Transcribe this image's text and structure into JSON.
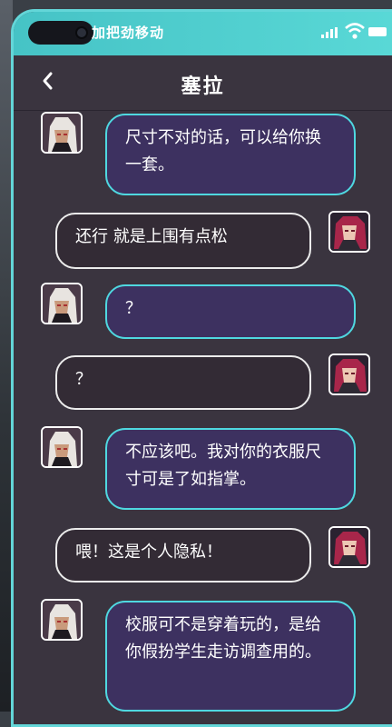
{
  "status_bar": {
    "carrier": "加把劲移动"
  },
  "header": {
    "back_icon": "chevron-left-icon",
    "title": "塞拉"
  },
  "messages": [
    {
      "side": "left",
      "speaker": "sierra",
      "text": "尺寸不对的话，可以给你换一套。"
    },
    {
      "side": "right",
      "speaker": "player",
      "text": "还行 就是上围有点松"
    },
    {
      "side": "left",
      "speaker": "sierra",
      "text": "？"
    },
    {
      "side": "right",
      "speaker": "player",
      "text": "？"
    },
    {
      "side": "left",
      "speaker": "sierra",
      "text": "不应该吧。我对你的衣服尺寸可是了如指掌。"
    },
    {
      "side": "right",
      "speaker": "player",
      "text": "喂！这是个人隐私！"
    },
    {
      "side": "left",
      "speaker": "sierra",
      "text": "校服可不是穿着玩的，是给你假扮学生走访调查用的。"
    }
  ],
  "colors": {
    "accent": "#4fd8e0",
    "background": "#3a343f",
    "left_bubble": "#3d3160",
    "right_bubble": "#332b35"
  }
}
